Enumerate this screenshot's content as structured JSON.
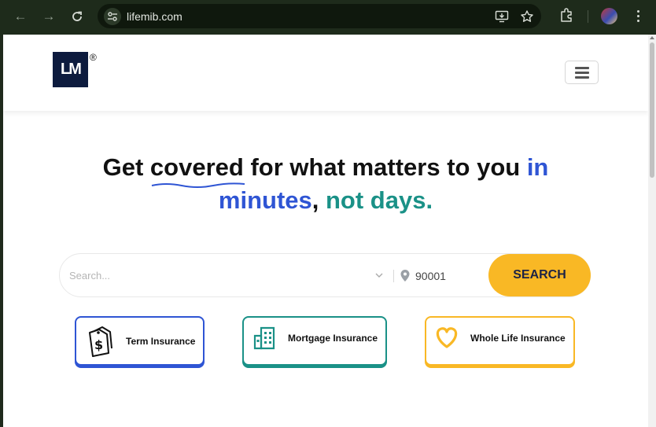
{
  "browser": {
    "url": "lifemib.com",
    "icons": [
      "back-arrow",
      "forward-arrow",
      "reload",
      "site-settings",
      "install-app",
      "bookmark-star",
      "extensions",
      "profile-avatar",
      "more-menu"
    ]
  },
  "header": {
    "logo_text": "LM",
    "registered_mark": "®",
    "menu_icon": "hamburger-menu"
  },
  "hero": {
    "part1": "Get ",
    "covered": "covered",
    "part2": " for what matters to you ",
    "in": "in",
    "minutes": "minutes",
    "comma": ",",
    "not_days": "not days."
  },
  "search": {
    "placeholder": "Search...",
    "zip": "90001",
    "button_label": "SEARCH"
  },
  "categories": [
    {
      "label": "Term Insurance",
      "icon": "price-tag-dollar",
      "color": "#2f55d4"
    },
    {
      "label": "Mortgage Insurance",
      "icon": "building",
      "color": "#1a9187"
    },
    {
      "label": "Whole Life Insurance",
      "icon": "heart",
      "color": "#f9b825"
    }
  ],
  "colors": {
    "accent_blue": "#2f55d4",
    "accent_teal": "#1a9187",
    "accent_yellow": "#f9b825",
    "logo_navy": "#0d1b3e"
  }
}
